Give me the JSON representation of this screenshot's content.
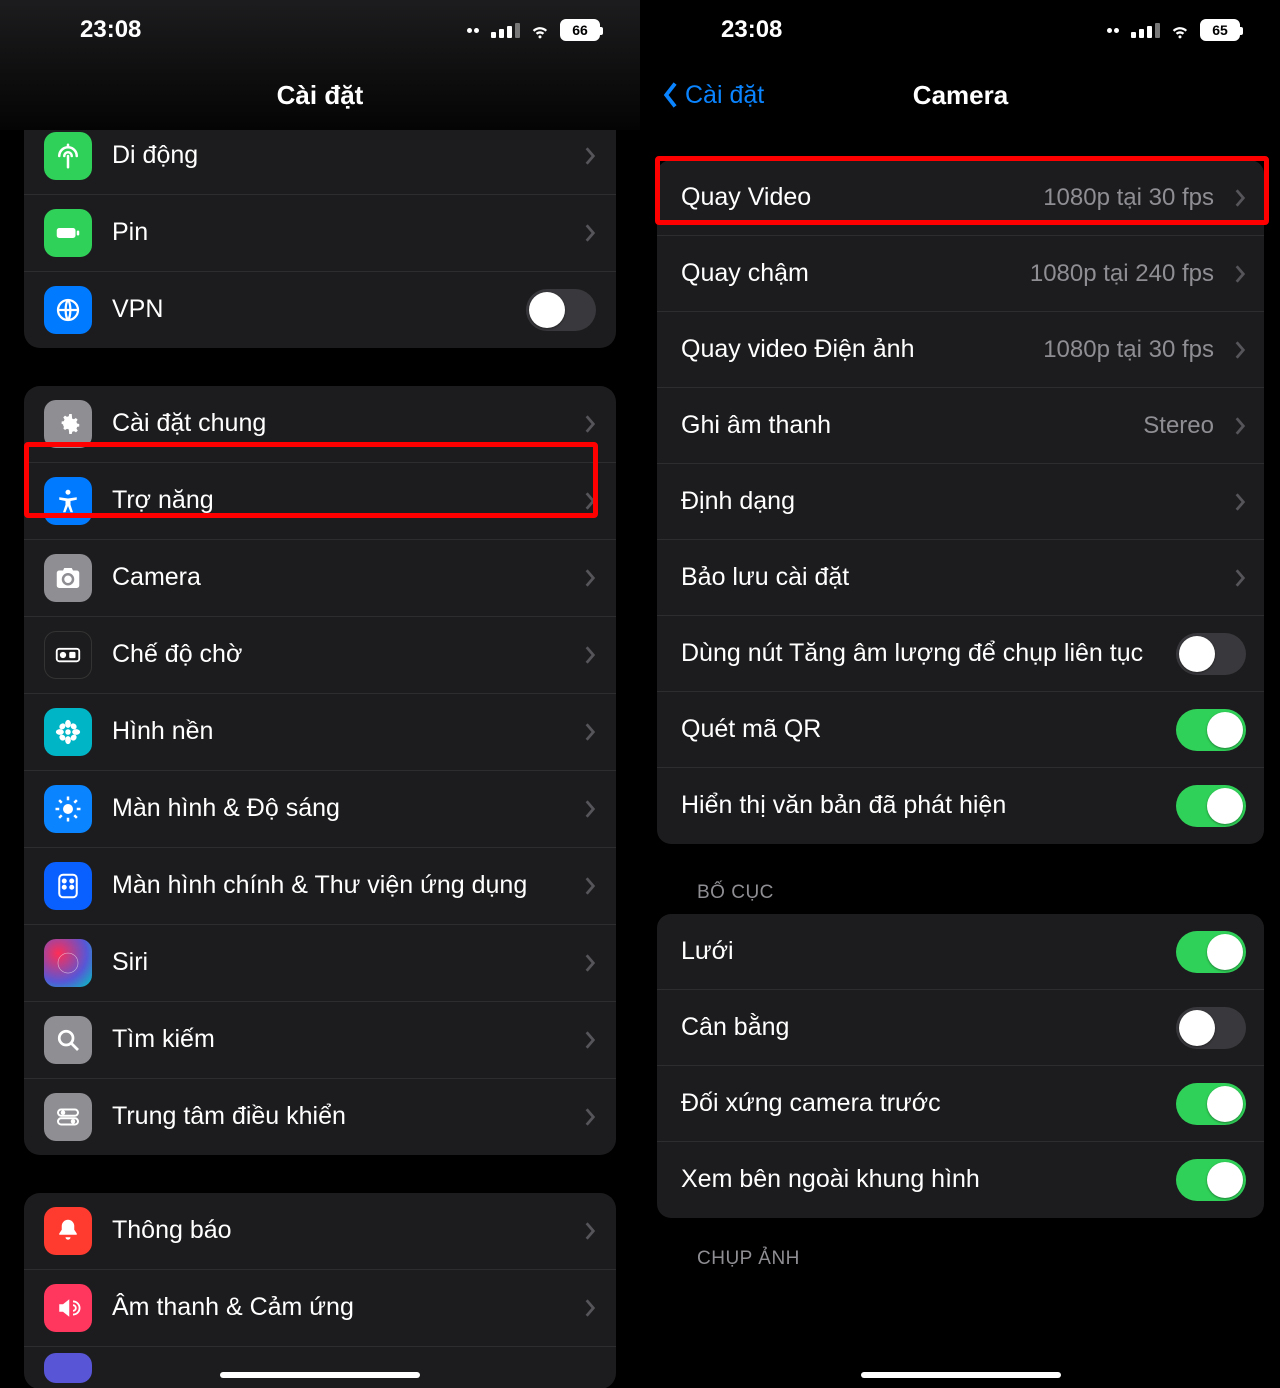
{
  "left": {
    "status": {
      "time": "23:08",
      "battery": "66"
    },
    "title": "Cài đặt",
    "group1": [
      {
        "icon": "antenna",
        "label": "Di động",
        "cut": true
      },
      {
        "icon": "battery",
        "label": "Pin"
      },
      {
        "icon": "vpn",
        "label": "VPN",
        "toggle": false
      }
    ],
    "group2": [
      {
        "icon": "gear",
        "label": "Cài đặt chung"
      },
      {
        "icon": "accessibility",
        "label": "Trợ năng"
      },
      {
        "icon": "camera",
        "label": "Camera",
        "highlight": true
      },
      {
        "icon": "standby",
        "label": "Chế độ chờ"
      },
      {
        "icon": "wallpaper",
        "label": "Hình nền"
      },
      {
        "icon": "brightness",
        "label": "Màn hình & Độ sáng"
      },
      {
        "icon": "homescreen",
        "label": "Màn hình chính & Thư viện ứng dụng"
      },
      {
        "icon": "siri",
        "label": "Siri"
      },
      {
        "icon": "search",
        "label": "Tìm kiếm"
      },
      {
        "icon": "control",
        "label": "Trung tâm điều khiển"
      }
    ],
    "group3": [
      {
        "icon": "notify",
        "label": "Thông báo"
      },
      {
        "icon": "sound",
        "label": "Âm thanh & Cảm ứng"
      }
    ]
  },
  "right": {
    "status": {
      "time": "23:08",
      "battery": "65"
    },
    "back": "Cài đặt",
    "title": "Camera",
    "group1": [
      {
        "label": "Quay Video",
        "value": "1080p tại 30 fps",
        "highlight": true
      },
      {
        "label": "Quay chậm",
        "value": "1080p tại 240 fps"
      },
      {
        "label": "Quay video Điện ảnh",
        "value": "1080p tại 30 fps"
      },
      {
        "label": "Ghi âm thanh",
        "value": "Stereo"
      },
      {
        "label": "Định dạng"
      },
      {
        "label": "Bảo lưu cài đặt"
      },
      {
        "label": "Dùng nút Tăng âm lượng để chụp liên tục",
        "toggle": false
      },
      {
        "label": "Quét mã QR",
        "toggle": true
      },
      {
        "label": "Hiển thị văn bản đã phát hiện",
        "toggle": true
      }
    ],
    "section2_header": "BỐ CỤC",
    "group2": [
      {
        "label": "Lưới",
        "toggle": true
      },
      {
        "label": "Cân bằng",
        "toggle": false
      },
      {
        "label": "Đối xứng camera trước",
        "toggle": true
      },
      {
        "label": "Xem bên ngoài khung hình",
        "toggle": true
      }
    ],
    "bottom_peek": "CHỤP ẢNH"
  }
}
